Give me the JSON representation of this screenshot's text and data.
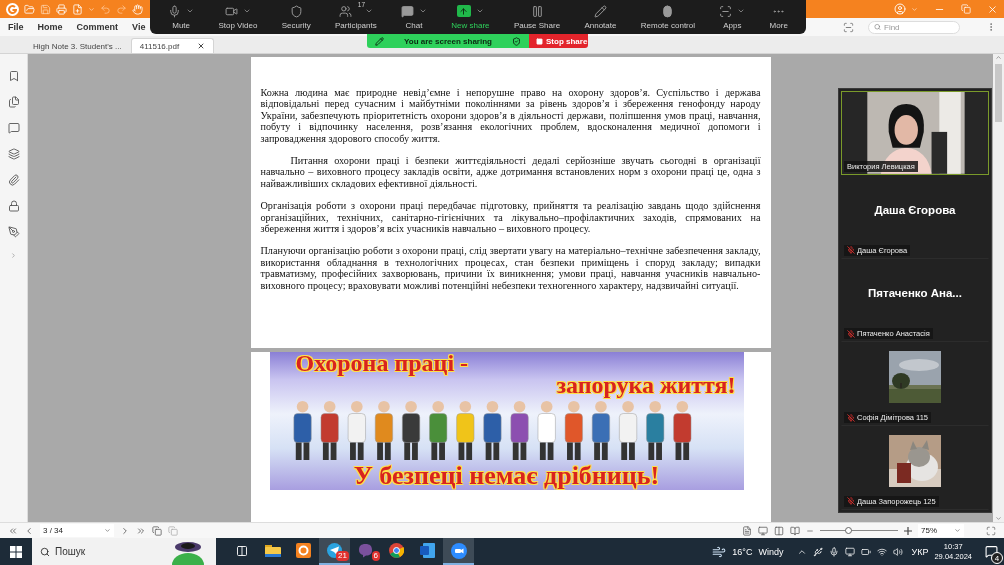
{
  "menu": [
    {
      "label": "File"
    },
    {
      "label": "Home"
    },
    {
      "label": "Comment"
    },
    {
      "label": "Vie"
    }
  ],
  "find": {
    "placeholder": "Find"
  },
  "tabs": [
    {
      "label": "High Note 3. Student's ...",
      "selected": false
    },
    {
      "label": "411516.pdf",
      "selected": true
    }
  ],
  "meeting_toolbar": {
    "items": [
      {
        "label": "Mute",
        "menu": true,
        "kind": "normal"
      },
      {
        "label": "Stop Video",
        "menu": true,
        "kind": "normal"
      },
      {
        "label": "Security",
        "menu": false,
        "kind": "normal"
      },
      {
        "label": "Participants",
        "menu": true,
        "kind": "normal",
        "count": "17"
      },
      {
        "label": "Chat",
        "menu": true,
        "kind": "normal"
      },
      {
        "label": "New share",
        "menu": true,
        "kind": "accent"
      },
      {
        "label": "Pause Share",
        "menu": false,
        "kind": "normal"
      },
      {
        "label": "Annotate",
        "menu": false,
        "kind": "normal"
      },
      {
        "label": "Remote control",
        "menu": false,
        "kind": "normal"
      },
      {
        "label": "Apps",
        "menu": true,
        "kind": "normal"
      },
      {
        "label": "More",
        "menu": false,
        "kind": "normal"
      }
    ]
  },
  "sharing": {
    "status": "You are screen sharing",
    "stop": "Stop share"
  },
  "document": {
    "paragraphs": [
      "Кожна людина має природне невід’ємне і непорушне право на охорону здоров’я. Суспільство і держава відповідальні перед сучасним і майбутніми поколіннями за рівень здоров’я і збереження генофонду народу України, забезпечують пріоритетність охорони здоров’я в діяльності держави, поліпшення умов праці, навчання, побуту і відпочинку населення, розв’язання екологічних проблем, вдосконалення медичної допомоги і запровадження здорового способу життя.",
      "Питання охорони праці і безпеки життєдіяльності дедалі серйозніше звучать сьогодні в організації навчально – виховного процесу закладів освіти, адже дотримання встановлених норм з охорони праці це, одна з найважливіших складових ефективної діяльності.",
      "Організація роботи з охорони праці передбачає підготовку, прийняття та реалізацію завдань щодо здійснення організаційних, технічних, санітарно-гігієнічних та лікувально–профілактичних заходів, спрямованих на збереження життя і здоров’я всіх учасників навчально – виховного процесу.",
      "Плануючи організацію роботи з охорони праці, слід звертати увагу на матеріально–технічне забезпечення закладу, використання обладнання в технологічних процесах, стан безпеки приміщень і споруд закладу; випадки травматизму, професійних захворювань, причини їх виникнення; умови праці, навчання учасників навчально-виховного процесу; враховувати можливі потенційні небезпеки техногенного характеру, надзвичайні ситуації."
    ],
    "banner": {
      "title_1": "Охорона праці -",
      "title_2": "запорука життя!",
      "slogan": "У безпеці немає дрібниць!"
    }
  },
  "participants": [
    {
      "kind": "video",
      "name": "Виктория Левицкая",
      "muted": false,
      "active": true
    },
    {
      "kind": "avatar",
      "title": "Даша Єгорова",
      "name": "Даша Єгорова",
      "muted": true,
      "active": false
    },
    {
      "kind": "avatar",
      "title": "Пятаченко  Ана...",
      "name": "Пятаченко Анастасія",
      "muted": true,
      "active": false
    },
    {
      "kind": "landscape",
      "name": "Софія Дімітрова 115",
      "muted": true,
      "active": false
    },
    {
      "kind": "pet",
      "name": "Даша Запорожець 125",
      "muted": true,
      "active": false
    }
  ],
  "status_bar": {
    "page": "3 / 34",
    "zoom": {
      "value": "75%",
      "level": 0.36
    }
  },
  "taskbar": {
    "search": {
      "placeholder": "Пошук"
    },
    "apps": [
      {
        "kind": "taskview",
        "active": false
      },
      {
        "kind": "folder",
        "active": false
      },
      {
        "kind": "editor",
        "active": false
      },
      {
        "kind": "messenger",
        "badge": "21",
        "active": true
      },
      {
        "kind": "phone",
        "badge": "6",
        "active": false
      },
      {
        "kind": "browser",
        "active": false
      },
      {
        "kind": "word",
        "active": false
      },
      {
        "kind": "video",
        "active": true
      }
    ],
    "weather": {
      "temperature": "16°C",
      "condition": "Windy"
    },
    "language": "УКР",
    "time": "10:37",
    "date": "29.04.2024",
    "notifications": "4"
  }
}
